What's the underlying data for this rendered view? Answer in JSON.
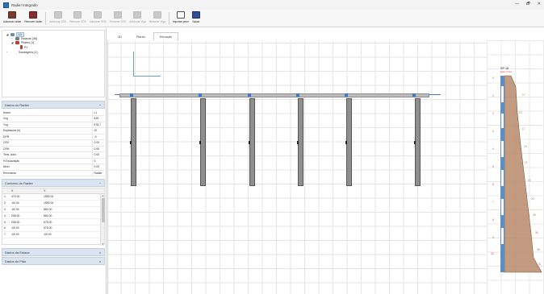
{
  "window": {
    "title": "Radier Integrado",
    "controls": [
      "—",
      "🗗",
      "✕"
    ]
  },
  "toolbar": {
    "buttons": [
      {
        "label": "Adicionar radier",
        "enabled": true,
        "color": "#7a3b2a"
      },
      {
        "label": "Remover radier",
        "enabled": true,
        "color": "#8a2d2d"
      },
      {
        "label": "Adicionar SOS",
        "enabled": false
      },
      {
        "label": "Remover SOS",
        "enabled": false
      },
      {
        "label": "Adicionar SOS",
        "enabled": false
      },
      {
        "label": "Remover SOS",
        "enabled": false
      },
      {
        "label": "Adicionar Viga",
        "enabled": false
      },
      {
        "label": "Remover Viga",
        "enabled": false
      },
      {
        "label": "Importar perm",
        "enabled": true,
        "color": "#5a5a5a"
      },
      {
        "label": "Salvar",
        "enabled": true,
        "color": "#2d4f95"
      }
    ]
  },
  "tree": {
    "root": "L1",
    "estacas": "Estacas (36)",
    "pilares": "Pilares (1)",
    "p1": "P1",
    "sondagens": "Sondagens (1)"
  },
  "properties": {
    "header": "Dados do Radier",
    "rows": [
      {
        "label": "Nome",
        "value": "L1"
      },
      {
        "label": "Xcg",
        "value": "815"
      },
      {
        "label": "Ycg",
        "value": "878.7"
      },
      {
        "label": "Espessura (h)",
        "value": "20"
      },
      {
        "label": "DPR",
        "value": "-0"
      },
      {
        "label": "CRV",
        "value": "0.00"
      },
      {
        "label": "CRH",
        "value": "0.00"
      },
      {
        "label": "Tens. Adm.",
        "value": "0.00"
      },
      {
        "label": "H Escavação",
        "value": "0"
      },
      {
        "label": "Nivel",
        "value": "0.00"
      },
      {
        "label": "Revimento",
        "value": "Radier"
      }
    ]
  },
  "contour": {
    "header": "Contorno do Radier",
    "columns": [
      "",
      "X",
      "Y"
    ],
    "rows": [
      {
        "i": "1",
        "x": "470.00",
        "y": "1590.00"
      },
      {
        "i": "2",
        "x": "-60.00",
        "y": "1590.00"
      },
      {
        "i": "3",
        "x": "-60.00",
        "y": "860.00"
      },
      {
        "i": "4",
        "x": "208.00",
        "y": "860.00"
      },
      {
        "i": "5",
        "x": "208.00",
        "y": "675.00"
      },
      {
        "i": "6",
        "x": "-60.00",
        "y": "675.00"
      },
      {
        "i": "7",
        "x": "-60.00",
        "y": "-60.00"
      }
    ]
  },
  "collapsed_sections": [
    "Dados da Estaca",
    "Dados do Pilar"
  ],
  "view_tabs": [
    {
      "label": "3D",
      "active": false
    },
    {
      "label": "Planta",
      "active": false
    },
    {
      "label": "Elevação",
      "active": true
    }
  ],
  "profile": {
    "title": "SP 16",
    "subtitle": "(cota: 0.0m)",
    "depths": [
      "0",
      "1",
      "2",
      "3",
      "4",
      "5",
      "6",
      "7",
      "8",
      "9",
      "10"
    ],
    "nspt": [
      "17",
      "13",
      "17",
      "19",
      "21",
      "20",
      "20",
      "28",
      "36",
      "38",
      "41"
    ]
  },
  "colors": {
    "accent": "#2f6fb3",
    "soil": "#b8896a",
    "pile": "#8f8f8f",
    "grid": "#e6e6e6"
  }
}
